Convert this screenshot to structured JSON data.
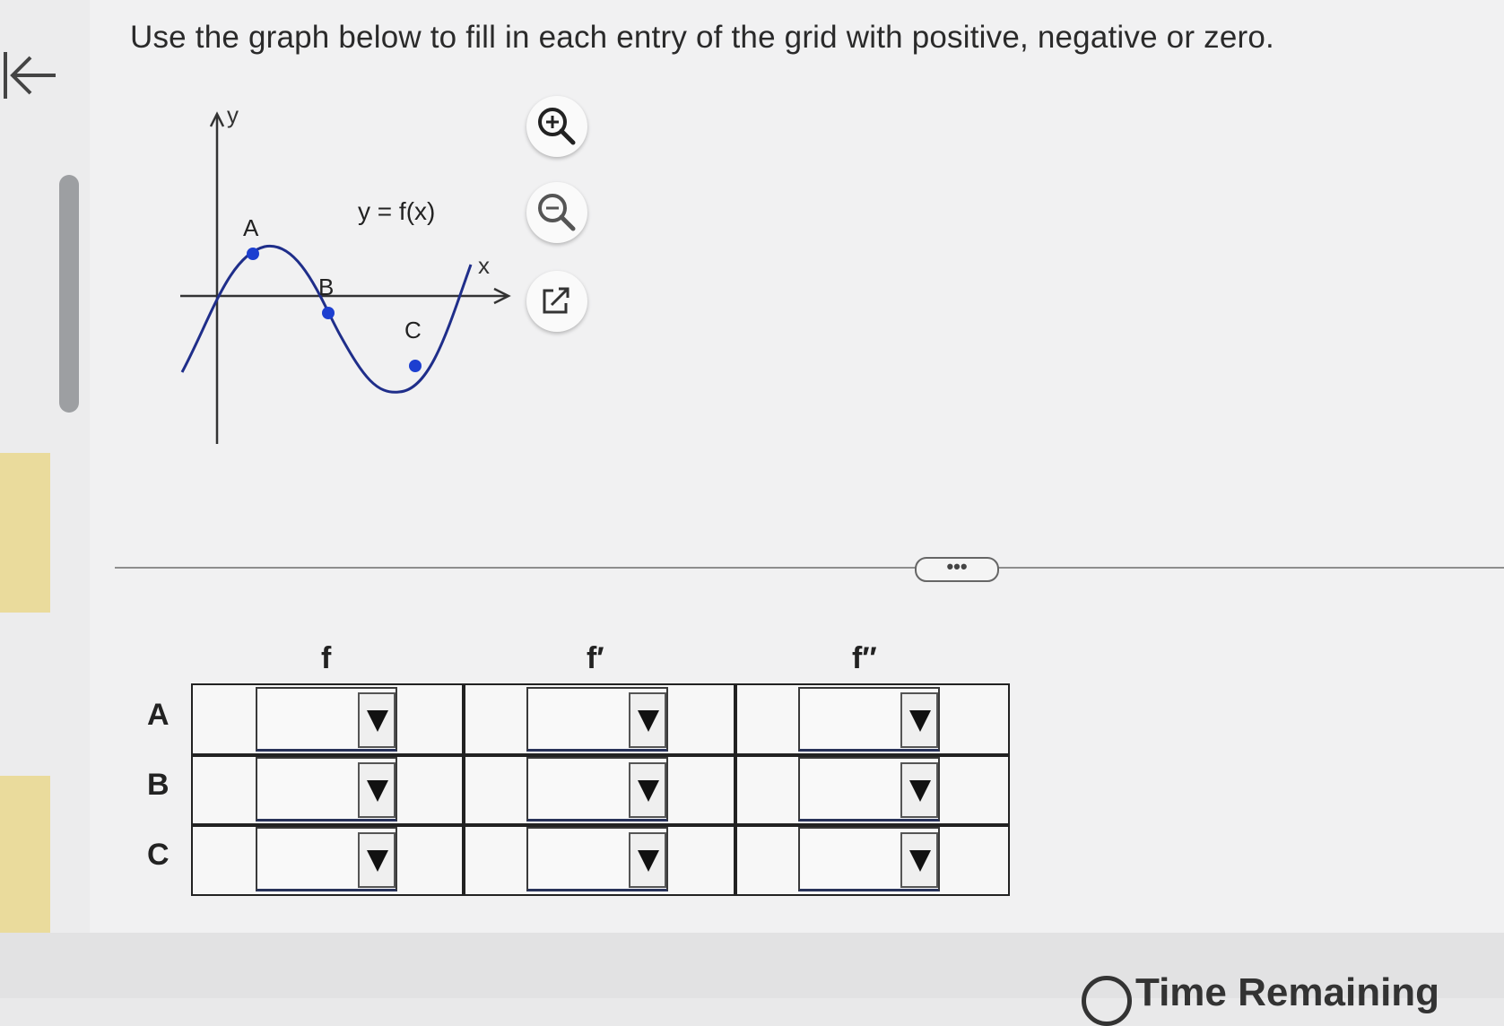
{
  "instructions": "Use the graph below to fill in each entry of the grid with positive, negative or zero.",
  "graph": {
    "y_axis_label": "y",
    "x_axis_label": "x",
    "function_label": "y = f(x)",
    "points": [
      "A",
      "B",
      "C"
    ],
    "curve_color": "#1f2e8a"
  },
  "tools": {
    "zoom_in": "zoom-in-icon",
    "zoom_out": "zoom-out-icon",
    "open_new": "external-link-icon"
  },
  "more_button": "•••",
  "grid": {
    "columns": [
      "f",
      "f′",
      "f′′"
    ],
    "rows": [
      "A",
      "B",
      "C"
    ]
  },
  "footer": {
    "partial_text": "Time Remaining"
  }
}
